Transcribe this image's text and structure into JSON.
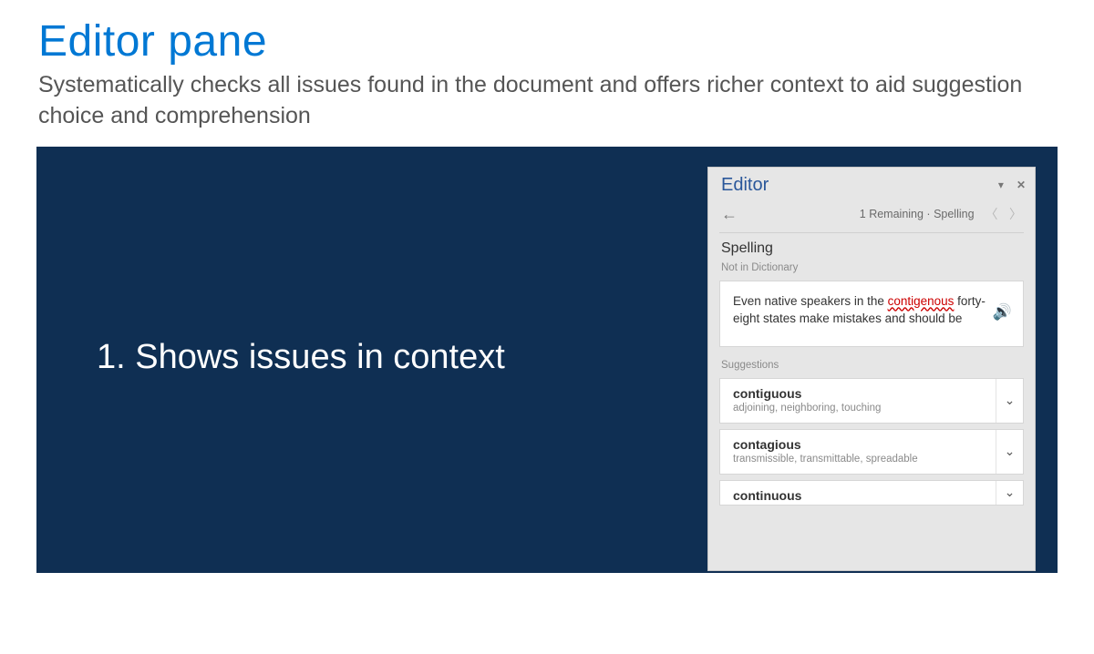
{
  "slide": {
    "title": "Editor pane",
    "description": "Systematically checks all issues found in the document and offers richer context to aid suggestion choice and comprehension",
    "bullet": "1. Shows issues in context"
  },
  "pane": {
    "title": "Editor",
    "remaining": "1 Remaining · Spelling",
    "sectionTitle": "Spelling",
    "subtle": "Not in Dictionary",
    "context_pre": "Even native speakers in the ",
    "context_flag": "contigenous",
    "context_post": " forty-eight states make mistakes and should be",
    "suggestionsLabel": "Suggestions",
    "suggestions": [
      {
        "word": "contiguous",
        "syn": "adjoining, neighboring, touching"
      },
      {
        "word": "contagious",
        "syn": "transmissible, transmittable, spreadable"
      },
      {
        "word": "continuous",
        "syn": ""
      }
    ]
  }
}
